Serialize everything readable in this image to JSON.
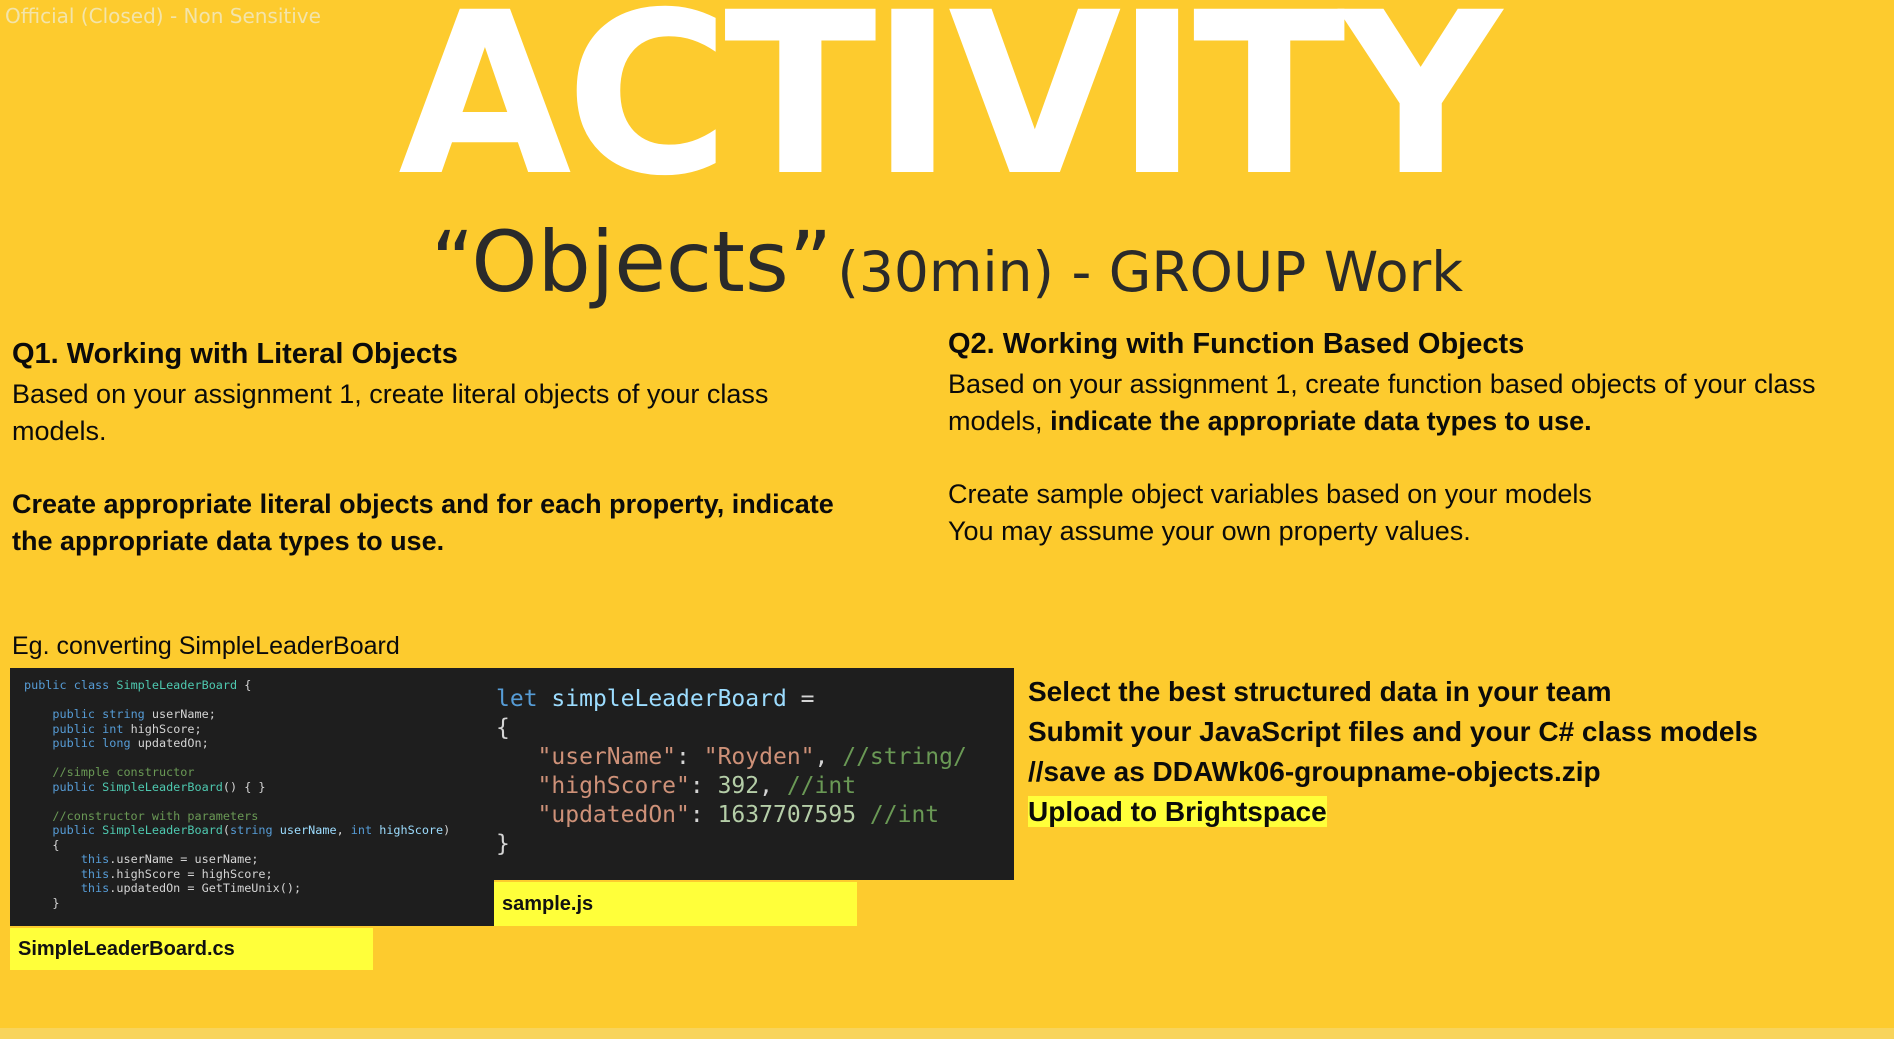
{
  "classification": "Official (Closed) - Non Sensitive",
  "title": "ACTIVITY",
  "subtitle": {
    "quoted": "“Objects”",
    "rest": "(30min) - GROUP Work"
  },
  "q1": {
    "title": "Q1. Working with Literal Objects",
    "text": "Based on your assignment 1, create literal objects of your class models.",
    "bold_text": "Create appropriate literal objects and for each property, indicate the appropriate data types to use."
  },
  "q2": {
    "title": "Q2. Working with Function Based Objects",
    "text": "Based on your assignment 1, create function based objects of your class models,",
    "text_bold": "indicate the appropriate data types to use.",
    "line2": "Create sample object variables based on your models",
    "line3": "You may assume your own property values."
  },
  "example_label": "Eg. converting SimpleLeaderBoard",
  "cs_code": {
    "kw_public": "public",
    "kw_class": "class",
    "class_name": "SimpleLeaderBoard",
    "kw_string": "string",
    "kw_int": "int",
    "kw_long": "long",
    "kw_this": "this",
    "f_username": "userName",
    "f_highscore": "highScore",
    "f_updatedon": "updatedOn",
    "comment1": "//simple constructor",
    "comment2": "//constructor with parameters",
    "ctor_empty_tail": "() { }",
    "get_time": "GetTimeUnix"
  },
  "js_code": {
    "kw_let": "let",
    "var_name": "simpleLeaderBoard",
    "key1": "\"userName\"",
    "val1": "\"Royden\"",
    "comment1": "//string/",
    "key2": "\"highScore\"",
    "val2": "392",
    "comment2": "//int",
    "key3": "\"updatedOn\"",
    "val3": "1637707595",
    "comment3": "//int"
  },
  "labels": {
    "js_file": "sample.js",
    "cs_file": "SimpleLeaderBoard.cs"
  },
  "instructions": {
    "line1": "Select the best structured data in your team",
    "line2": "Submit your JavaScript files and your C# class models",
    "line3": "//save as DDAWk06-groupname-objects.zip",
    "line4": "Upload to Brightspace"
  },
  "colors": {
    "background": "#FDCB2E",
    "highlight": "#FFFF3A",
    "code_bg": "#1E1E1E"
  }
}
